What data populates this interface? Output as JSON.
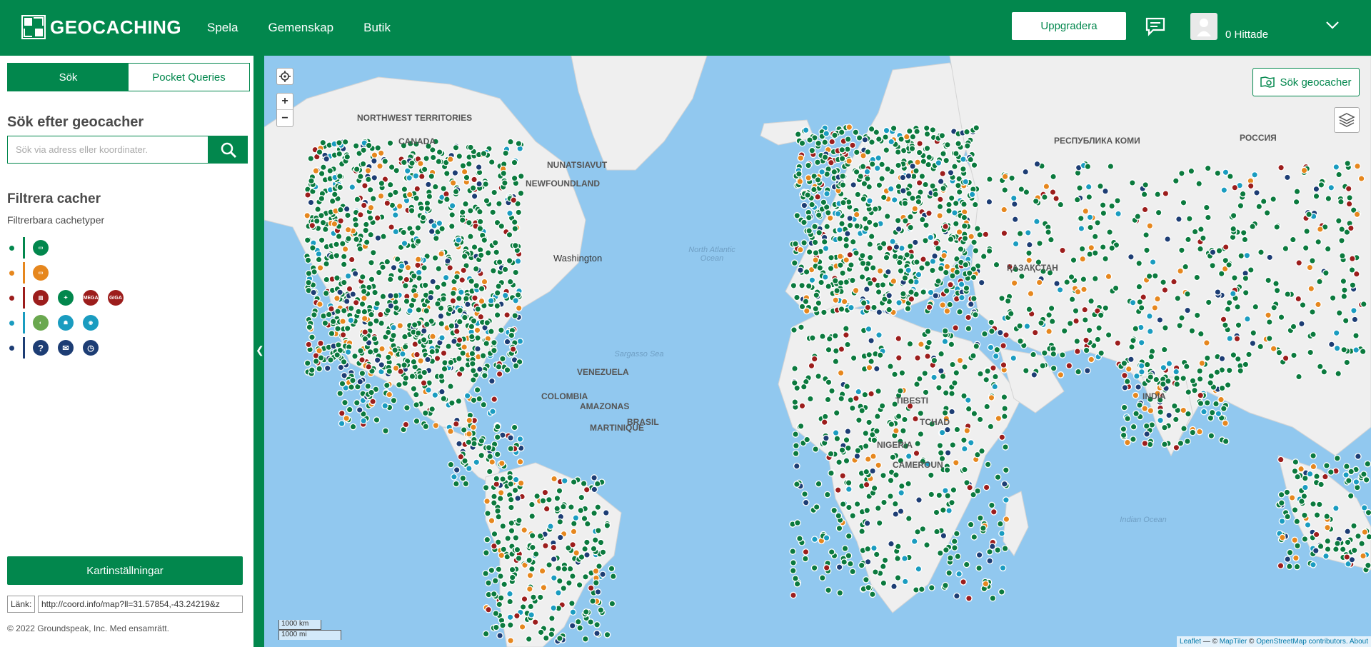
{
  "brand": {
    "name": "GEOCACHING",
    "color": "#02874d"
  },
  "nav": {
    "items": [
      "Spela",
      "Gemenskap",
      "Butik"
    ]
  },
  "header": {
    "upgrade_label": "Uppgradera",
    "found_label": "0 Hittade"
  },
  "sidebar": {
    "tabs": [
      {
        "label": "Sök",
        "active": true
      },
      {
        "label": "Pocket Queries",
        "active": false
      }
    ],
    "search_title": "Sök efter geocacher",
    "search_placeholder": "Sök via adress eller koordinater.",
    "filter_title": "Filtrera cacher",
    "filter_subtitle": "Filtrerbara cachetyper",
    "filter_groups": [
      {
        "color": "#02874d",
        "icons": [
          "traditional-cache-icon"
        ]
      },
      {
        "color": "#e6871e",
        "icons": [
          "multi-cache-icon"
        ]
      },
      {
        "color": "#9c1d1c",
        "icons": [
          "event-cache-icon",
          "cito-event-icon",
          "mega-event-icon",
          "giga-event-icon"
        ]
      },
      {
        "color": "#1a9cc0",
        "icons": [
          "earthcache-icon",
          "virtual-cache-icon",
          "webcam-cache-icon"
        ]
      },
      {
        "color": "#1d3d74",
        "icons": [
          "mystery-cache-icon",
          "letterbox-cache-icon",
          "wherigo-cache-icon"
        ]
      }
    ],
    "mega_label": "MEGA",
    "giga_label": "GIGA",
    "map_settings_label": "Kartinställningar",
    "link_label": "Länk:",
    "link_value": "http://coord.info/map?ll=31.57854,-43.24219&z",
    "copyright": "© 2022 Groundspeak, Inc. Med ensamrätt."
  },
  "map": {
    "search_geocaches_label": "Sök geocacher",
    "scale_km": "1000 km",
    "scale_mi": "1000 mi",
    "attribution": {
      "leaflet": "Leaflet",
      "sep": " — © ",
      "maptiler": "MapTiler",
      "osm": "OpenStreetMap contributors.",
      "about": "About"
    },
    "labels": [
      "NORTHWEST TERRITORIES",
      "CANADA",
      "NUNATSIAVUT",
      "NEWFOUNDLAND",
      "Washington",
      "BRASIL",
      "COLOMBIA",
      "VENEZUELA",
      "AMAZONAS",
      "NIGERIA",
      "TCHAD",
      "CAMEROUN",
      "РЕСПУБЛИКА КОМИ",
      "РОССИЯ",
      "ҚАЗАҚСТАН",
      "INDIA",
      "TIBESTI",
      "MARTINIQUE"
    ],
    "ocean_labels": [
      "North Atlantic Ocean",
      "Sargasso Sea",
      "Indian Ocean"
    ],
    "marker_colors": {
      "traditional": "#0b7a3e",
      "multi": "#e6871e",
      "event": "#9c1d1c",
      "earth": "#1a9cc0",
      "mystery": "#1d3d74"
    }
  }
}
